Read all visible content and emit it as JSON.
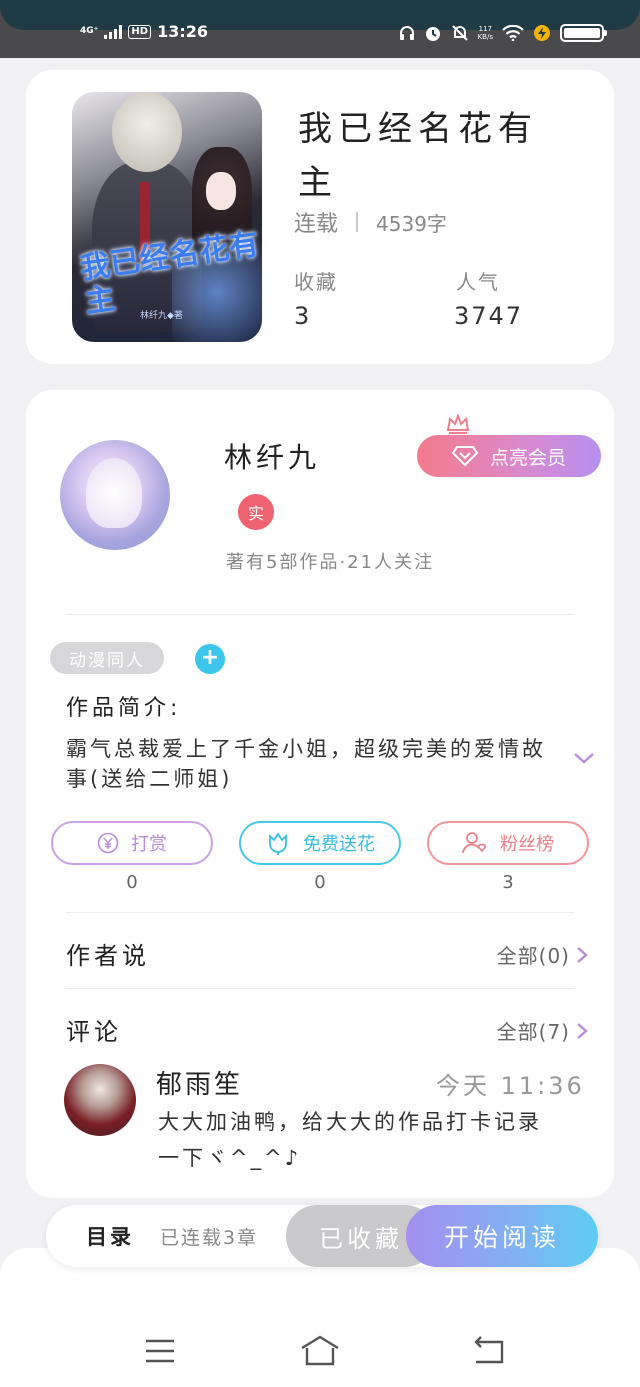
{
  "status_bar": {
    "network": "4G⁺",
    "hd": "HD",
    "time": "13:26",
    "speed_value": "117",
    "speed_unit": "KB/s"
  },
  "book": {
    "cover_title": "我已经名花有主",
    "cover_author": "林纤九◆著",
    "title": "我已经名花有主",
    "status": "连载",
    "word_count": "4539字",
    "favorites_label": "收藏",
    "favorites_value": "3",
    "popularity_label": "人气",
    "popularity_value": "3747"
  },
  "author": {
    "name": "林纤九",
    "vip_button": "点亮会员",
    "real_badge": "实",
    "stats": "著有5部作品·21人关注"
  },
  "tags": {
    "tag1": "动漫同人",
    "add_symbol": "+"
  },
  "intro": {
    "label": "作品简介:",
    "text": "霸气总裁爱上了千金小姐，超级完美的爱情故事(送给二师姐)"
  },
  "actions": {
    "reward_label": "打赏",
    "reward_count": "0",
    "flower_label": "免费送花",
    "flower_count": "0",
    "fans_label": "粉丝榜",
    "fans_count": "3"
  },
  "author_says": {
    "title": "作者说",
    "link": "全部(0)"
  },
  "comments": {
    "title": "评论",
    "link": "全部(7)",
    "items": [
      {
        "user": "郁雨笙",
        "time": "今天 11:36",
        "text": "大大加油鸭，给大大的作品打卡记录一下ヾ^_^♪"
      }
    ]
  },
  "bottom_bar": {
    "toc": "目录",
    "chapters": "已连载3章",
    "collected": "已收藏",
    "start_reading": "开始阅读"
  },
  "colors": {
    "accent_gradient_start": "#a48ef0",
    "accent_gradient_end": "#5dcdf4",
    "vip_gradient_start": "#f47a8a",
    "vip_gradient_end": "#b78ff0"
  }
}
